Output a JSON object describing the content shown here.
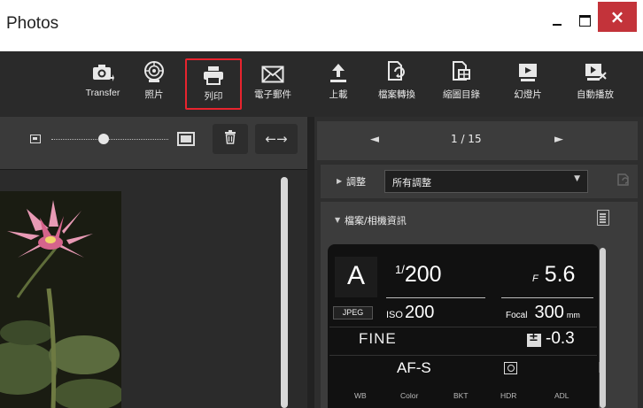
{
  "window": {
    "title": "Photos",
    "close_glyph": "×"
  },
  "toolbar": {
    "items": [
      {
        "label": "Transfer",
        "icon": "camera-transfer-icon"
      },
      {
        "label": "照片",
        "icon": "photos-icon"
      },
      {
        "label": "列印",
        "icon": "print-icon",
        "active": true
      },
      {
        "label": "電子郵件",
        "icon": "email-icon"
      },
      {
        "label": "上載",
        "icon": "upload-icon"
      },
      {
        "label": "檔案轉換",
        "icon": "file-convert-icon"
      },
      {
        "label": "縮圖目錄",
        "icon": "thumbnail-index-icon"
      },
      {
        "label": "幻燈片",
        "icon": "slideshow-icon"
      },
      {
        "label": "自動播放",
        "icon": "autoplay-icon"
      }
    ],
    "active_outline_color": "#e8242e"
  },
  "viewer": {
    "arrows_glyph": "←→",
    "zoom_level": 0.45
  },
  "navigator": {
    "prev_glyph": "◄",
    "counter": "1 / 15",
    "next_glyph": "►"
  },
  "adjustments": {
    "label": "調整",
    "selected": "所有調整",
    "caret": "▼"
  },
  "file_info": {
    "label": "檔案/相機資訊",
    "mode": "A",
    "shutter_speed": "1/200",
    "aperture_prefix": "F",
    "aperture": "5.6",
    "format": "JPEG",
    "iso_label": "ISO",
    "iso": "200",
    "focal_label": "Focal",
    "focal_length": "300",
    "focal_unit": "mm",
    "quality": "FINE",
    "exposure_comp": "-0.3",
    "af_mode": "AF-S",
    "bottom_labels": [
      "WB",
      "Color",
      "BKT",
      "HDR",
      "ADL"
    ]
  }
}
